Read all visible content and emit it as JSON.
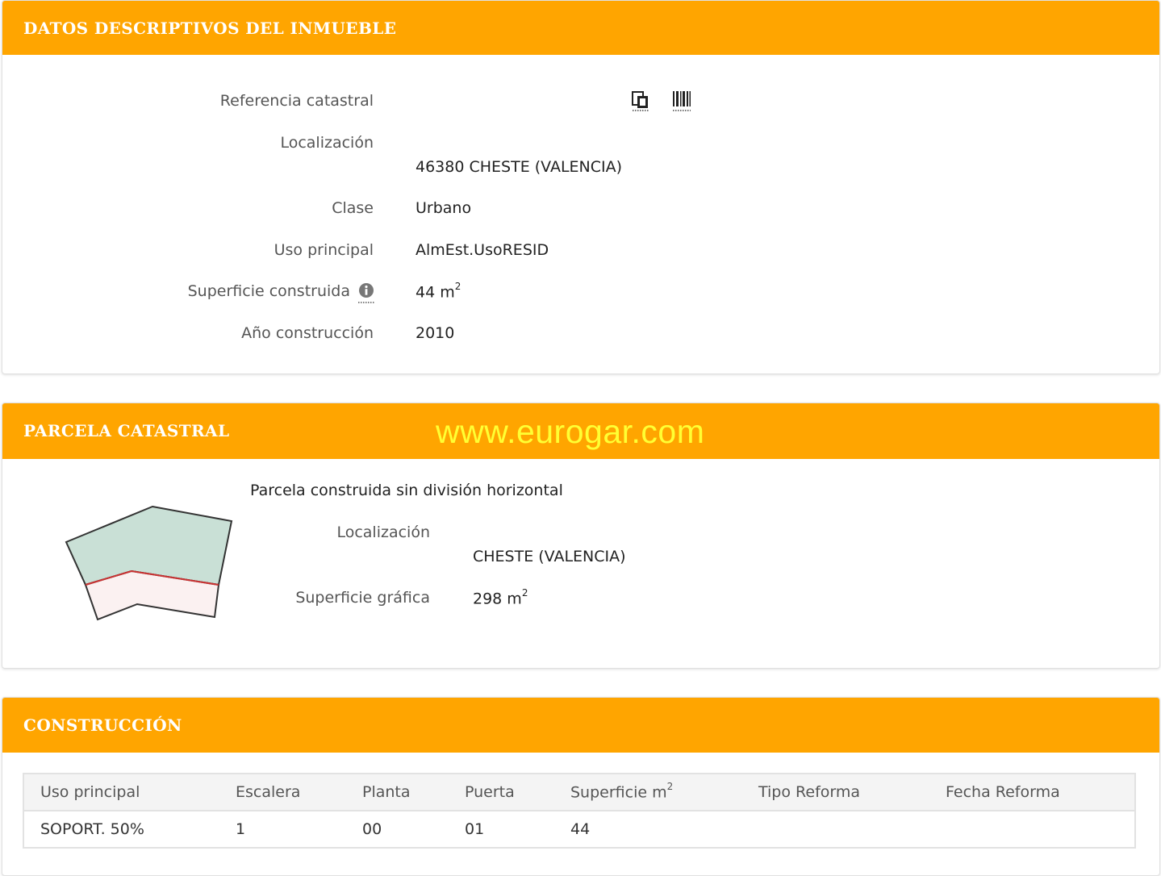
{
  "colors": {
    "header_bg": "#ffa500",
    "header_text": "#ffffff",
    "watermark": "#ffff33"
  },
  "datos": {
    "title": "DATOS DESCRIPTIVOS DEL INMUEBLE",
    "ref_label": "Referencia catastral",
    "ref_icons": [
      "copy-document-icon",
      "barcode-icon"
    ],
    "localizacion_label": "Localización",
    "localizacion_value": "46380 CHESTE (VALENCIA)",
    "clase_label": "Clase",
    "clase_value": "Urbano",
    "uso_label": "Uso principal",
    "uso_value": "AlmEst.UsoRESID",
    "superficie_label": "Superficie construida",
    "superficie_value": "44 m",
    "superficie_sup": "2",
    "superficie_icon": "info-icon",
    "anio_label": "Año construcción",
    "anio_value": "2010"
  },
  "parcela": {
    "title": "PARCELA CATASTRAL",
    "watermark": "www.eurogar.com",
    "heading": "Parcela construida sin división horizontal",
    "localizacion_label": "Localización",
    "localizacion_value": "CHESTE (VALENCIA)",
    "superficie_label": "Superficie gráfica",
    "superficie_value": "298 m",
    "superficie_sup": "2"
  },
  "construccion": {
    "title": "CONSTRUCCIÓN",
    "headers": [
      "Uso principal",
      "Escalera",
      "Planta",
      "Puerta",
      "Superficie m",
      "Tipo Reforma",
      "Fecha Reforma"
    ],
    "superficie_header_sup": "2",
    "rows": [
      [
        "SOPORT. 50%",
        "1",
        "00",
        "01",
        "44",
        "",
        ""
      ]
    ]
  }
}
